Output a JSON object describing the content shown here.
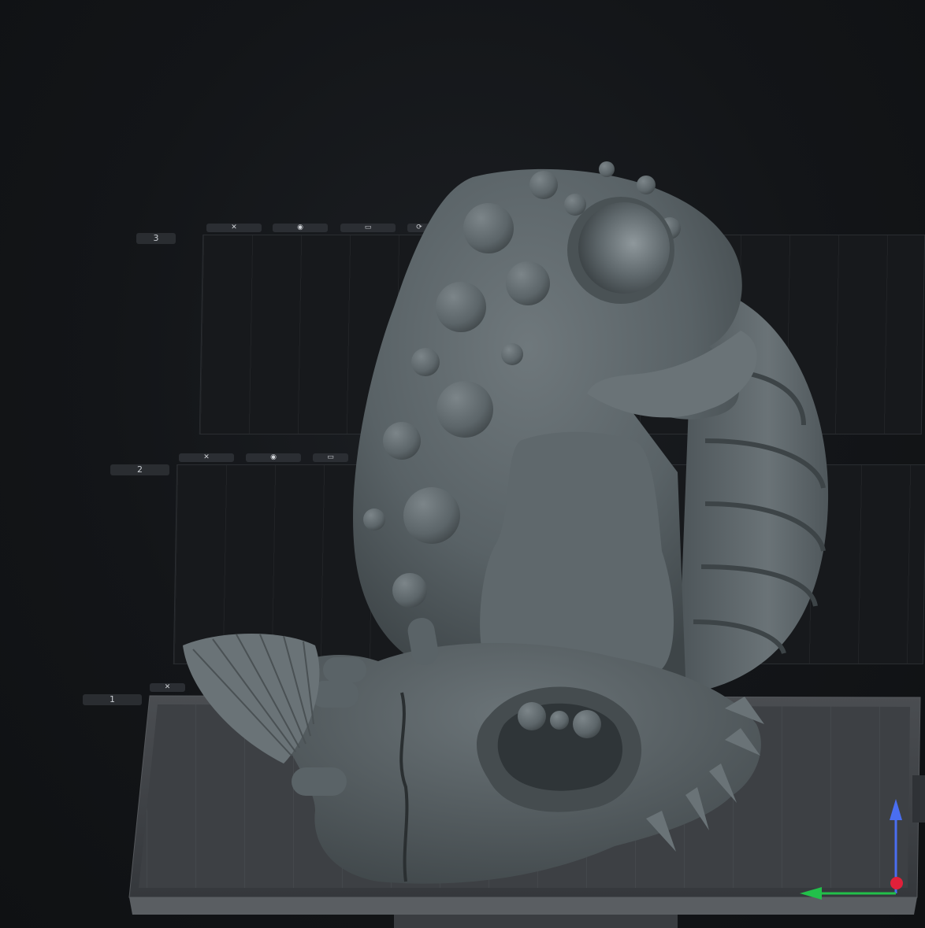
{
  "scene": {
    "plates": [
      {
        "index_label": "3",
        "tools": [
          "✕",
          "◉",
          "▭",
          "⟳"
        ]
      },
      {
        "index_label": "2",
        "tools": [
          "✕",
          "◉",
          "▭"
        ]
      },
      {
        "index_label": "1",
        "tools": [
          "✕"
        ]
      }
    ],
    "model_name": "sculpted-creature-model",
    "colors": {
      "background": "#111315",
      "model": "#5b6468",
      "plate": "#3a3d41",
      "axis_x": "#e0203a",
      "axis_y": "#22c04a",
      "axis_z": "#4a6ef0"
    },
    "icons": [
      "move-icon",
      "view-icon",
      "plate-icon",
      "arrange-icon"
    ]
  }
}
